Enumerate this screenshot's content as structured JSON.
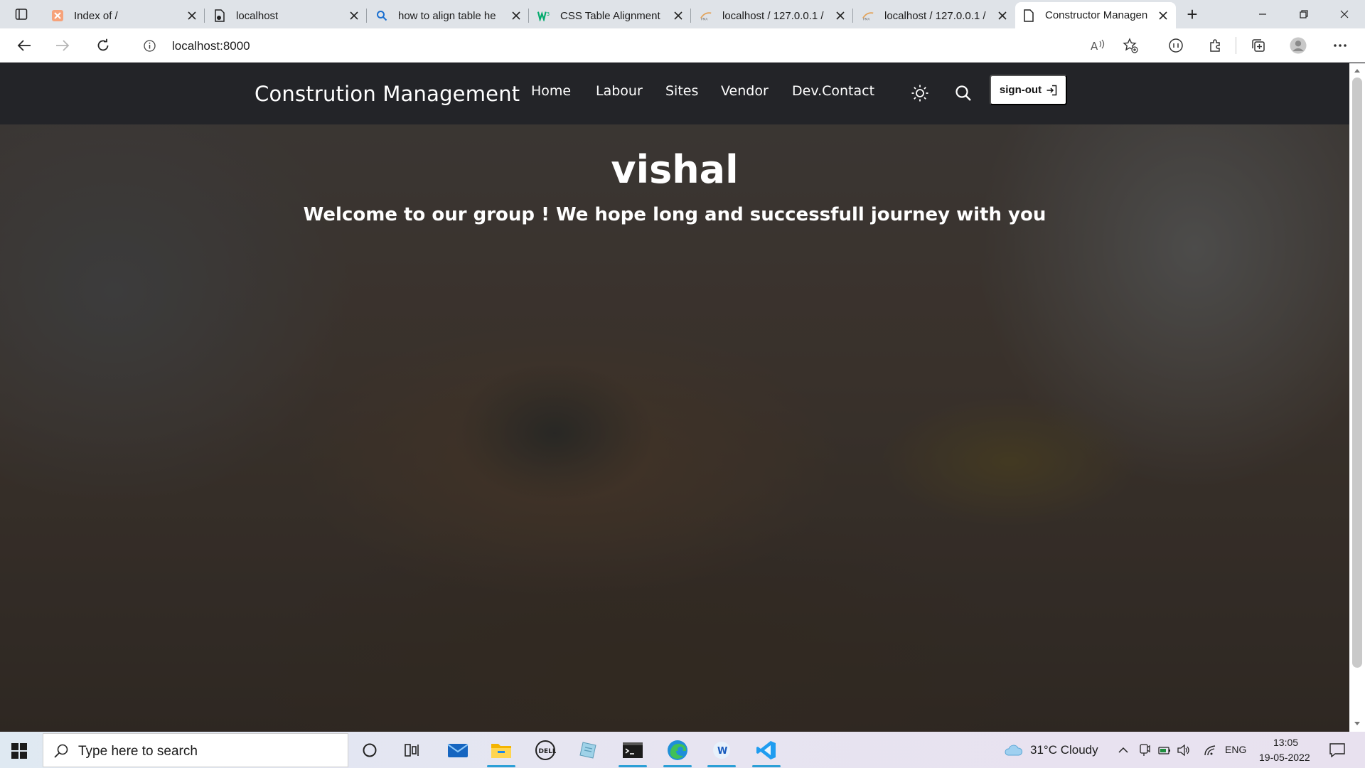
{
  "browser": {
    "tabs": [
      {
        "title": "Index of /",
        "icon": "xampp-icon"
      },
      {
        "title": "localhost",
        "icon": "page-icon"
      },
      {
        "title": "how to align table he",
        "icon": "search-icon"
      },
      {
        "title": "CSS Table Alignment",
        "icon": "w3schools-icon"
      },
      {
        "title": "localhost / 127.0.0.1 /",
        "icon": "phpmyadmin-icon"
      },
      {
        "title": "localhost / 127.0.0.1 /",
        "icon": "phpmyadmin-icon"
      },
      {
        "title": "Constructor Managen",
        "icon": "page-icon",
        "active": true
      }
    ],
    "new_tab_label": "+",
    "address": "localhost:8000"
  },
  "site": {
    "brand": "Constrution Management",
    "nav": [
      "Home",
      "Labour",
      "Sites",
      "Vendor",
      "Dev.Contact"
    ],
    "signout_label": "sign-out",
    "hero_title": "vishal",
    "hero_subtitle": "Welcome to our group ! We hope long and successfull journey with you"
  },
  "taskbar": {
    "search_placeholder": "Type here to search",
    "weather": "31°C  Cloudy",
    "language": "ENG",
    "time": "13:05",
    "date": "19-05-2022"
  },
  "colors": {
    "navbar": "#232428",
    "tabstrip": "#dfe3e8",
    "accent": "#2a9fd6"
  }
}
